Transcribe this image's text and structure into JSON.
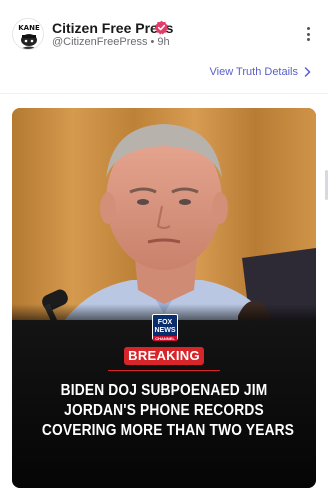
{
  "post": {
    "author_name": "Citizen Free Press",
    "handle": "@CitizenFreePress",
    "separator": "•",
    "timestamp": "9h",
    "avatar_text": "KANE",
    "view_details_label": "View Truth Details"
  },
  "media": {
    "logo_text": "FOX NEWS",
    "logo_subtext": "CHANNEL",
    "badge": "BREAKING",
    "headline_lines": [
      "BIDEN DOJ SUBPOENAED JIM",
      "JORDAN'S PHONE RECORDS",
      "COVERING MORE THAN TWO YEARS"
    ]
  },
  "colors": {
    "accent_link": "#5a5fc9",
    "verified_badge": "#e23c6a",
    "breaking_red": "#d6262a"
  },
  "icons": [
    "verified-badge-icon",
    "more-options-icon",
    "chevron-right-icon"
  ]
}
